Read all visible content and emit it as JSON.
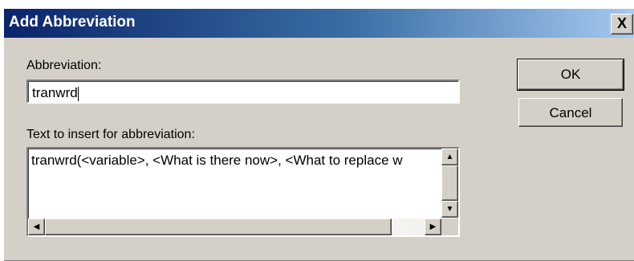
{
  "window": {
    "title": "Add Abbreviation",
    "close_label": "X"
  },
  "form": {
    "abbreviation_label": "Abbreviation:",
    "abbreviation_value": "tranwrd",
    "text_label": "Text to insert for abbreviation:",
    "text_value": "tranwrd(<variable>, <What is there now>, <What to replace w"
  },
  "buttons": {
    "ok_label": "OK",
    "cancel_label": "Cancel"
  },
  "scrollbars": {
    "up_arrow": "▲",
    "down_arrow": "▼",
    "left_arrow": "◀",
    "right_arrow": "▶"
  },
  "colors": {
    "titlebar_start": "#0a246a",
    "titlebar_end": "#a6caf0",
    "dialog_background": "#d4d0c8"
  }
}
